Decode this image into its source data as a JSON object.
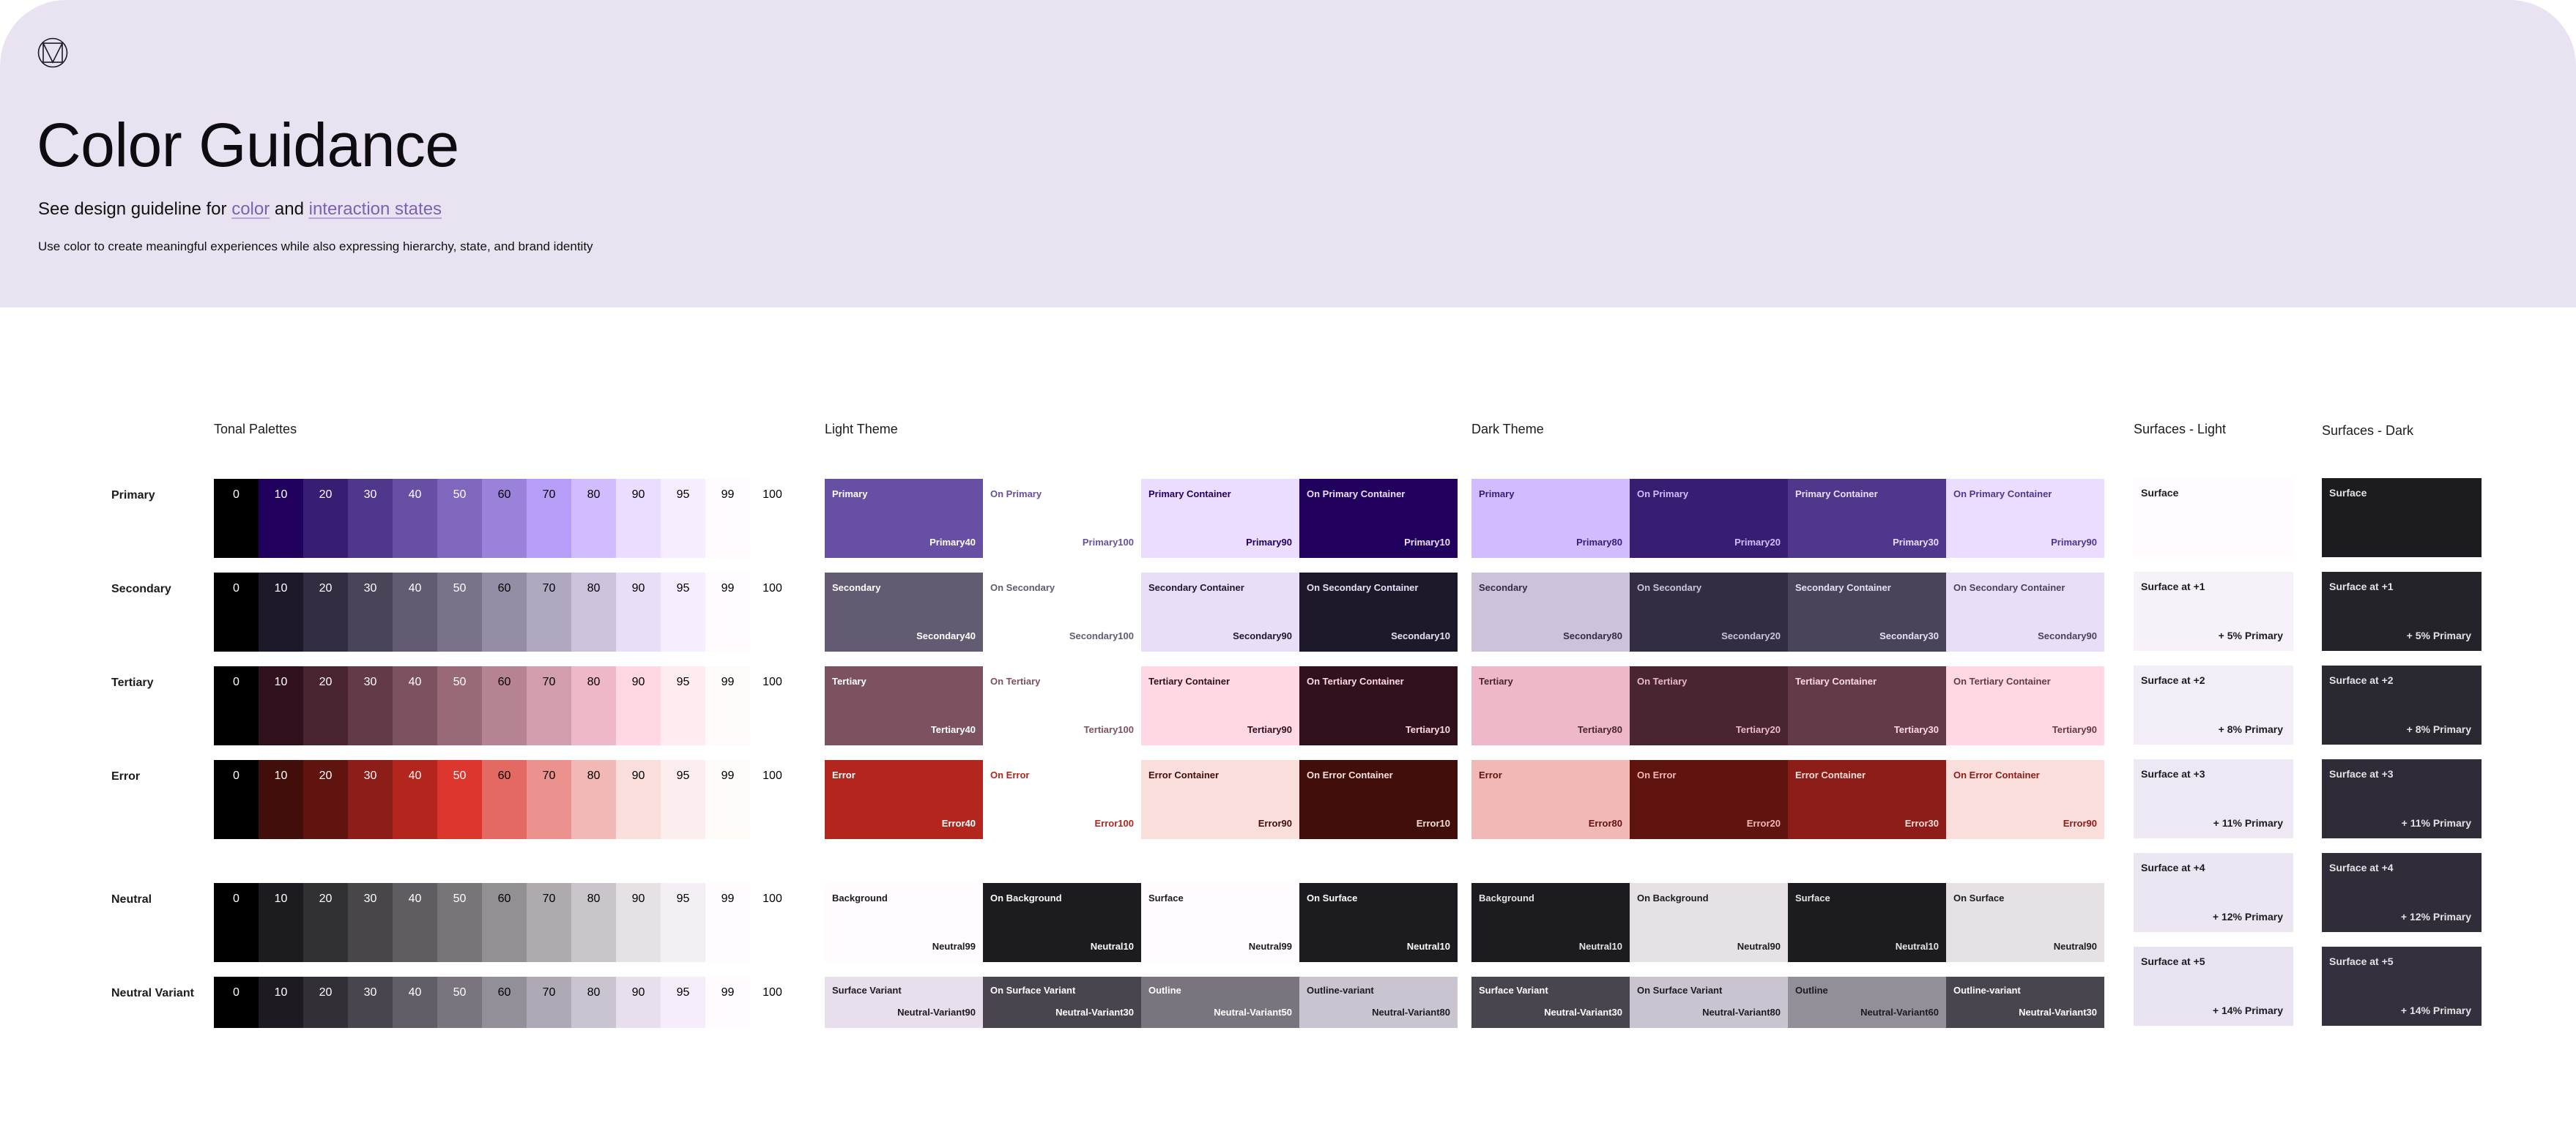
{
  "header": {
    "title": "Color Guidance",
    "subtitle_prefix": "See design guideline for ",
    "link_color": "color",
    "subtitle_and": " and ",
    "link_interaction": "interaction states",
    "description": "Use color to create meaningful experiences while also expressing hierarchy, state, and brand identity",
    "logo_icon": "material-logo-icon",
    "background": "#e9e3f1"
  },
  "sections": {
    "tonal": "Tonal Palettes",
    "light": "Light Theme",
    "dark": "Dark Theme",
    "surfaces_light": "Surfaces - Light",
    "surfaces_dark": "Surfaces - Dark"
  },
  "tonal_palettes": [
    {
      "name": "Primary",
      "tones": [
        {
          "t": "0",
          "c": "#000000"
        },
        {
          "t": "10",
          "c": "#21005d"
        },
        {
          "t": "20",
          "c": "#381e72"
        },
        {
          "t": "30",
          "c": "#4f378b"
        },
        {
          "t": "40",
          "c": "#6750a4"
        },
        {
          "t": "50",
          "c": "#7f67be"
        },
        {
          "t": "60",
          "c": "#9a82db"
        },
        {
          "t": "70",
          "c": "#b69df8"
        },
        {
          "t": "80",
          "c": "#d0bcff"
        },
        {
          "t": "90",
          "c": "#eaddff"
        },
        {
          "t": "95",
          "c": "#f6edff"
        },
        {
          "t": "99",
          "c": "#fffbfe"
        },
        {
          "t": "100",
          "c": "#ffffff"
        }
      ]
    },
    {
      "name": "Secondary",
      "tones": [
        {
          "t": "0",
          "c": "#000000"
        },
        {
          "t": "10",
          "c": "#1d192b"
        },
        {
          "t": "20",
          "c": "#332d41"
        },
        {
          "t": "30",
          "c": "#4a4458"
        },
        {
          "t": "40",
          "c": "#625b71"
        },
        {
          "t": "50",
          "c": "#7a7289"
        },
        {
          "t": "60",
          "c": "#958da5"
        },
        {
          "t": "70",
          "c": "#b0a7c0"
        },
        {
          "t": "80",
          "c": "#ccc2dc"
        },
        {
          "t": "90",
          "c": "#e8def8"
        },
        {
          "t": "95",
          "c": "#f6edff"
        },
        {
          "t": "99",
          "c": "#fffbfe"
        },
        {
          "t": "100",
          "c": "#ffffff"
        }
      ]
    },
    {
      "name": "Tertiary",
      "tones": [
        {
          "t": "0",
          "c": "#000000"
        },
        {
          "t": "10",
          "c": "#31111d"
        },
        {
          "t": "20",
          "c": "#492532"
        },
        {
          "t": "30",
          "c": "#633b48"
        },
        {
          "t": "40",
          "c": "#7d5260"
        },
        {
          "t": "50",
          "c": "#986977"
        },
        {
          "t": "60",
          "c": "#b58392"
        },
        {
          "t": "70",
          "c": "#d29dac"
        },
        {
          "t": "80",
          "c": "#efb8c8"
        },
        {
          "t": "90",
          "c": "#ffd8e4"
        },
        {
          "t": "95",
          "c": "#ffecf1"
        },
        {
          "t": "99",
          "c": "#fffbfa"
        },
        {
          "t": "100",
          "c": "#ffffff"
        }
      ]
    },
    {
      "name": "Error",
      "tones": [
        {
          "t": "0",
          "c": "#000000"
        },
        {
          "t": "10",
          "c": "#410e0b"
        },
        {
          "t": "20",
          "c": "#601410"
        },
        {
          "t": "30",
          "c": "#8c1d18"
        },
        {
          "t": "40",
          "c": "#b3261e"
        },
        {
          "t": "50",
          "c": "#dc362e"
        },
        {
          "t": "60",
          "c": "#e46962"
        },
        {
          "t": "70",
          "c": "#ec928e"
        },
        {
          "t": "80",
          "c": "#f2b8b5"
        },
        {
          "t": "90",
          "c": "#f9dedc"
        },
        {
          "t": "95",
          "c": "#fceeee"
        },
        {
          "t": "99",
          "c": "#fffbf9"
        },
        {
          "t": "100",
          "c": "#ffffff"
        }
      ]
    },
    {
      "name": "Neutral",
      "tones": [
        {
          "t": "0",
          "c": "#000000"
        },
        {
          "t": "10",
          "c": "#1c1b1f"
        },
        {
          "t": "20",
          "c": "#313033"
        },
        {
          "t": "30",
          "c": "#484649"
        },
        {
          "t": "40",
          "c": "#605d62"
        },
        {
          "t": "50",
          "c": "#787579"
        },
        {
          "t": "60",
          "c": "#939094"
        },
        {
          "t": "70",
          "c": "#aeaaae"
        },
        {
          "t": "80",
          "c": "#c9c5ca"
        },
        {
          "t": "90",
          "c": "#e6e1e5"
        },
        {
          "t": "95",
          "c": "#f4eff4"
        },
        {
          "t": "99",
          "c": "#fffbfe"
        },
        {
          "t": "100",
          "c": "#ffffff"
        }
      ]
    },
    {
      "name": "Neutral Variant",
      "tones": [
        {
          "t": "0",
          "c": "#000000"
        },
        {
          "t": "10",
          "c": "#1d1a22"
        },
        {
          "t": "20",
          "c": "#322f37"
        },
        {
          "t": "30",
          "c": "#49454f"
        },
        {
          "t": "40",
          "c": "#605d66"
        },
        {
          "t": "50",
          "c": "#79747e"
        },
        {
          "t": "60",
          "c": "#938f99"
        },
        {
          "t": "70",
          "c": "#aea9b4"
        },
        {
          "t": "80",
          "c": "#cac4d0"
        },
        {
          "t": "90",
          "c": "#e7e0ec"
        },
        {
          "t": "95",
          "c": "#f5eefa"
        },
        {
          "t": "99",
          "c": "#fffbfe"
        },
        {
          "t": "100",
          "c": "#ffffff"
        }
      ]
    }
  ],
  "light_theme": [
    [
      {
        "name": "Primary",
        "tone": "Primary40",
        "bg": "#6750a4",
        "fg": "#ffffff"
      },
      {
        "name": "On Primary",
        "tone": "Primary100",
        "bg": "#ffffff",
        "fg": "#6750a4"
      },
      {
        "name": "Primary Container",
        "tone": "Primary90",
        "bg": "#eaddff",
        "fg": "#21005d"
      },
      {
        "name": "On Primary Container",
        "tone": "Primary10",
        "bg": "#21005d",
        "fg": "#eaddff"
      }
    ],
    [
      {
        "name": "Secondary",
        "tone": "Secondary40",
        "bg": "#625b71",
        "fg": "#ffffff"
      },
      {
        "name": "On Secondary",
        "tone": "Secondary100",
        "bg": "#ffffff",
        "fg": "#625b71"
      },
      {
        "name": "Secondary Container",
        "tone": "Secondary90",
        "bg": "#e8def8",
        "fg": "#1d192b"
      },
      {
        "name": "On Secondary Container",
        "tone": "Secondary10",
        "bg": "#1d192b",
        "fg": "#e8def8"
      }
    ],
    [
      {
        "name": "Tertiary",
        "tone": "Tertiary40",
        "bg": "#7d5260",
        "fg": "#ffffff"
      },
      {
        "name": "On Tertiary",
        "tone": "Tertiary100",
        "bg": "#ffffff",
        "fg": "#7d5260"
      },
      {
        "name": "Tertiary Container",
        "tone": "Tertiary90",
        "bg": "#ffd8e4",
        "fg": "#31111d"
      },
      {
        "name": "On Tertiary Container",
        "tone": "Tertiary10",
        "bg": "#31111d",
        "fg": "#ffd8e4"
      }
    ],
    [
      {
        "name": "Error",
        "tone": "Error40",
        "bg": "#b3261e",
        "fg": "#ffffff"
      },
      {
        "name": "On Error",
        "tone": "Error100",
        "bg": "#ffffff",
        "fg": "#b3261e"
      },
      {
        "name": "Error Container",
        "tone": "Error90",
        "bg": "#f9dedc",
        "fg": "#410e0b"
      },
      {
        "name": "On Error Container",
        "tone": "Error10",
        "bg": "#410e0b",
        "fg": "#f9dedc"
      }
    ],
    [
      {
        "name": "Background",
        "tone": "Neutral99",
        "bg": "#fffbfe",
        "fg": "#1c1b1f"
      },
      {
        "name": "On Background",
        "tone": "Neutral10",
        "bg": "#1c1b1f",
        "fg": "#fffbfe"
      },
      {
        "name": "Surface",
        "tone": "Neutral99",
        "bg": "#fffbfe",
        "fg": "#1c1b1f"
      },
      {
        "name": "On Surface",
        "tone": "Neutral10",
        "bg": "#1c1b1f",
        "fg": "#fffbfe"
      }
    ],
    [
      {
        "name": "Surface Variant",
        "tone": "Neutral-Variant90",
        "bg": "#e7e0ec",
        "fg": "#1c1b1f"
      },
      {
        "name": "On Surface Variant",
        "tone": "Neutral-Variant30",
        "bg": "#49454f",
        "fg": "#ffffff"
      },
      {
        "name": "Outline",
        "tone": "Neutral-Variant50",
        "bg": "#79747e",
        "fg": "#ffffff"
      },
      {
        "name": "Outline-variant",
        "tone": "Neutral-Variant80",
        "bg": "#cac4d0",
        "fg": "#1c1b1f"
      }
    ]
  ],
  "dark_theme": [
    [
      {
        "name": "Primary",
        "tone": "Primary80",
        "bg": "#d0bcff",
        "fg": "#381e72"
      },
      {
        "name": "On Primary",
        "tone": "Primary20",
        "bg": "#381e72",
        "fg": "#d0bcff"
      },
      {
        "name": "Primary Container",
        "tone": "Primary30",
        "bg": "#4f378b",
        "fg": "#eaddff"
      },
      {
        "name": "On Primary Container",
        "tone": "Primary90",
        "bg": "#eaddff",
        "fg": "#4f378b"
      }
    ],
    [
      {
        "name": "Secondary",
        "tone": "Secondary80",
        "bg": "#ccc2dc",
        "fg": "#332d41"
      },
      {
        "name": "On Secondary",
        "tone": "Secondary20",
        "bg": "#332d41",
        "fg": "#ccc2dc"
      },
      {
        "name": "Secondary Container",
        "tone": "Secondary30",
        "bg": "#4a4458",
        "fg": "#e8def8"
      },
      {
        "name": "On Secondary Container",
        "tone": "Secondary90",
        "bg": "#e8def8",
        "fg": "#4a4458"
      }
    ],
    [
      {
        "name": "Tertiary",
        "tone": "Tertiary80",
        "bg": "#efb8c8",
        "fg": "#492532"
      },
      {
        "name": "On Tertiary",
        "tone": "Tertiary20",
        "bg": "#492532",
        "fg": "#efb8c8"
      },
      {
        "name": "Tertiary Container",
        "tone": "Tertiary30",
        "bg": "#633b48",
        "fg": "#ffd8e4"
      },
      {
        "name": "On Tertiary Container",
        "tone": "Tertiary90",
        "bg": "#ffd8e4",
        "fg": "#633b48"
      }
    ],
    [
      {
        "name": "Error",
        "tone": "Error80",
        "bg": "#f2b8b5",
        "fg": "#601410"
      },
      {
        "name": "On Error",
        "tone": "Error20",
        "bg": "#601410",
        "fg": "#f2b8b5"
      },
      {
        "name": "Error Container",
        "tone": "Error30",
        "bg": "#8c1d18",
        "fg": "#f9dedc"
      },
      {
        "name": "On Error Container",
        "tone": "Error90",
        "bg": "#f9dedc",
        "fg": "#8c1d18"
      }
    ],
    [
      {
        "name": "Background",
        "tone": "Neutral10",
        "bg": "#1c1b1f",
        "fg": "#e6e1e5"
      },
      {
        "name": "On Background",
        "tone": "Neutral90",
        "bg": "#e6e1e5",
        "fg": "#1c1b1f"
      },
      {
        "name": "Surface",
        "tone": "Neutral10",
        "bg": "#1c1b1f",
        "fg": "#e6e1e5"
      },
      {
        "name": "On Surface",
        "tone": "Neutral90",
        "bg": "#e6e1e5",
        "fg": "#1c1b1f"
      }
    ],
    [
      {
        "name": "Surface Variant",
        "tone": "Neutral-Variant30",
        "bg": "#49454f",
        "fg": "#ffffff"
      },
      {
        "name": "On Surface Variant",
        "tone": "Neutral-Variant80",
        "bg": "#cac4d0",
        "fg": "#1c1b1f"
      },
      {
        "name": "Outline",
        "tone": "Neutral-Variant60",
        "bg": "#938f99",
        "fg": "#1c1b1f"
      },
      {
        "name": "Outline-variant",
        "tone": "Neutral-Variant30",
        "bg": "#49454f",
        "fg": "#ffffff"
      }
    ]
  ],
  "surfaces_light": [
    {
      "name": "Surface",
      "pct": "",
      "bg": "#fffbfe",
      "fg": "#1c1b1f"
    },
    {
      "name": "Surface at +1",
      "pct": "+ 5% Primary",
      "bg": "#f7f2fa",
      "fg": "#1c1b1f"
    },
    {
      "name": "Surface at +2",
      "pct": "+ 8% Primary",
      "bg": "#f3edf7",
      "fg": "#1c1b1f"
    },
    {
      "name": "Surface at +3",
      "pct": "+ 11% Primary",
      "bg": "#eee8f4",
      "fg": "#1c1b1f"
    },
    {
      "name": "Surface at +4",
      "pct": "+ 12% Primary",
      "bg": "#ece6f3",
      "fg": "#1c1b1f"
    },
    {
      "name": "Surface at +5",
      "pct": "+ 14% Primary",
      "bg": "#e9e3f1",
      "fg": "#1c1b1f"
    }
  ],
  "surfaces_dark": [
    {
      "name": "Surface",
      "pct": "",
      "bg": "#1c1b1f",
      "fg": "#e6e1e5"
    },
    {
      "name": "Surface at +1",
      "pct": "+ 5% Primary",
      "bg": "#25232a",
      "fg": "#e6e1e5"
    },
    {
      "name": "Surface at +2",
      "pct": "+ 8% Primary",
      "bg": "#2a2831",
      "fg": "#e6e1e5"
    },
    {
      "name": "Surface at +3",
      "pct": "+ 11% Primary",
      "bg": "#2f2c37",
      "fg": "#e6e1e5"
    },
    {
      "name": "Surface at +4",
      "pct": "+ 12% Primary",
      "bg": "#302d39",
      "fg": "#e6e1e5"
    },
    {
      "name": "Surface at +5",
      "pct": "+ 14% Primary",
      "bg": "#34303d",
      "fg": "#e6e1e5"
    }
  ]
}
